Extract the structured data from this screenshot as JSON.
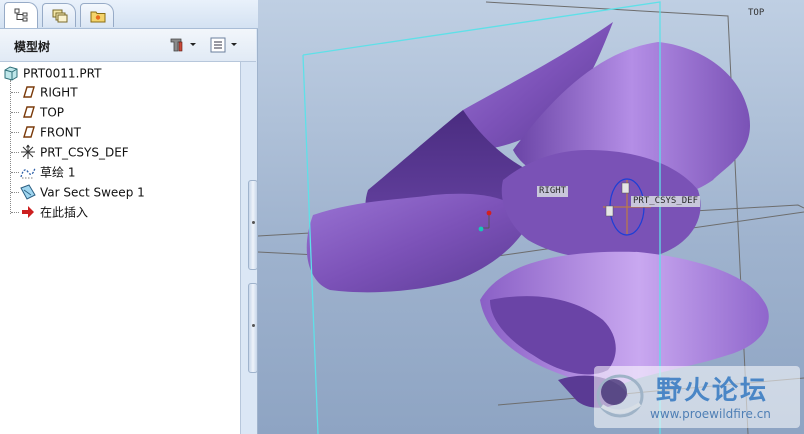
{
  "panel": {
    "title": "模型树",
    "tabs": [
      "model-tree-tab",
      "layers-tab",
      "folder-tab"
    ]
  },
  "tree": {
    "root": "PRT0011.PRT",
    "items": [
      {
        "label": "RIGHT",
        "icon": "datum-plane-icon"
      },
      {
        "label": "TOP",
        "icon": "datum-plane-icon"
      },
      {
        "label": "FRONT",
        "icon": "datum-plane-icon"
      },
      {
        "label": "PRT_CSYS_DEF",
        "icon": "coordinate-system-icon"
      },
      {
        "label": "草绘 1",
        "icon": "sketch-icon"
      },
      {
        "label": "Var Sect Sweep 1",
        "icon": "sweep-feature-icon"
      },
      {
        "label": "在此插入",
        "icon": "insert-here-arrow-icon"
      }
    ]
  },
  "viewport": {
    "labels": {
      "top": "TOP",
      "right": "RIGHT",
      "csys": "PRT_CSYS_DEF"
    }
  },
  "watermark": {
    "title": "野火论坛",
    "url": "www.proewildfire.cn"
  },
  "colors": {
    "accent": "#4a86c6",
    "model_purple": "#8b62c4",
    "datum_cyan": "#5fe0e8",
    "insert_red": "#cc1f1f"
  }
}
